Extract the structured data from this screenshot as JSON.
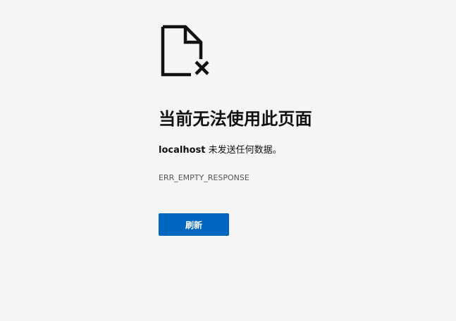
{
  "error_page": {
    "icon": "document-error-icon",
    "title": "当前无法使用此页面",
    "message": {
      "host": "localhost",
      "text": " 未发送任何数据。"
    },
    "error_code": "ERR_EMPTY_RESPONSE",
    "reload_label": "刷新"
  },
  "colors": {
    "background": "#f5f5f5",
    "button": "#0067c0",
    "error_code": "#555555"
  }
}
